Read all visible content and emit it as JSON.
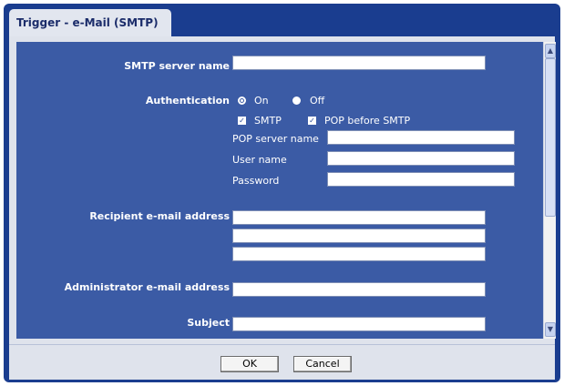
{
  "tab": {
    "label": "Trigger - e-Mail (SMTP)"
  },
  "form": {
    "smtp_server_name": {
      "label": "SMTP server name",
      "value": ""
    },
    "authentication": {
      "label": "Authentication",
      "on_label": "On",
      "off_label": "Off",
      "selected": "On",
      "smtp_label": "SMTP",
      "smtp_checked": true,
      "pop_before_smtp_label": "POP before SMTP",
      "pop_before_smtp_checked": true,
      "pop_server_name": {
        "label": "POP server name",
        "value": ""
      },
      "user_name": {
        "label": "User name",
        "value": ""
      },
      "password": {
        "label": "Password",
        "value": ""
      }
    },
    "recipient_email_address": {
      "label": "Recipient e-mail address",
      "values": [
        "",
        "",
        ""
      ]
    },
    "administrator_email_address": {
      "label": "Administrator e-mail address",
      "value": ""
    },
    "subject": {
      "label": "Subject",
      "value": ""
    }
  },
  "buttons": {
    "ok": "OK",
    "cancel": "Cancel"
  },
  "colors": {
    "frame": "#1a3d8f",
    "content": "#3b5ba5",
    "panel": "#dfe3ec"
  },
  "icons": {
    "scroll_up": "chevron-up-icon",
    "scroll_down": "chevron-down-icon",
    "checkbox": "check-icon"
  }
}
